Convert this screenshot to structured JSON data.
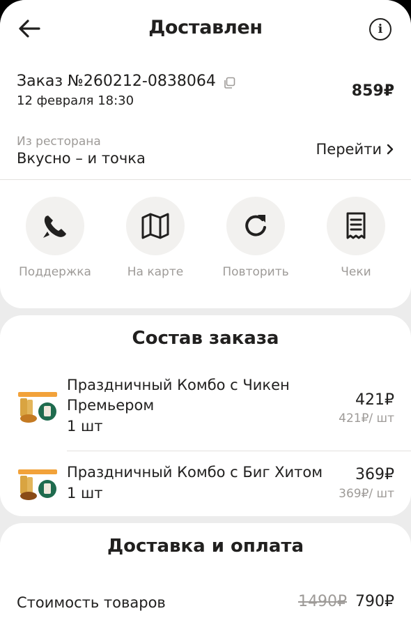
{
  "header": {
    "title": "Доставлен"
  },
  "order": {
    "number": "Заказ №260212-0838064",
    "date": "12 февраля 18:30",
    "total": "859₽"
  },
  "restaurant": {
    "caption": "Из ресторана",
    "name": "Вкусно – и точка",
    "link_label": "Перейти"
  },
  "actions": [
    {
      "label": "Поддержка",
      "icon": "phone-icon"
    },
    {
      "label": "На карте",
      "icon": "map-icon"
    },
    {
      "label": "Повторить",
      "icon": "repeat-icon"
    },
    {
      "label": "Чеки",
      "icon": "receipt-icon"
    }
  ],
  "order_contents": {
    "title": "Состав заказа",
    "items": [
      {
        "name": "Праздничный Комбо с Чикен Премьером",
        "qty": "1 шт",
        "price": "421₽",
        "unit_price": "421₽/ шт"
      },
      {
        "name": "Праздничный Комбо с Биг Хитом",
        "qty": "1 шт",
        "price": "369₽",
        "unit_price": "369₽/ шт"
      }
    ]
  },
  "delivery": {
    "title": "Доставка и оплата",
    "goods_cost_label": "Стоимость товаров",
    "goods_cost_old": "1490₽",
    "goods_cost_new": "790₽"
  },
  "colors": {
    "text": "#21201f",
    "muted": "#9e9b98",
    "circle_bg": "#f2f1ef",
    "page_bg": "#ececec"
  }
}
